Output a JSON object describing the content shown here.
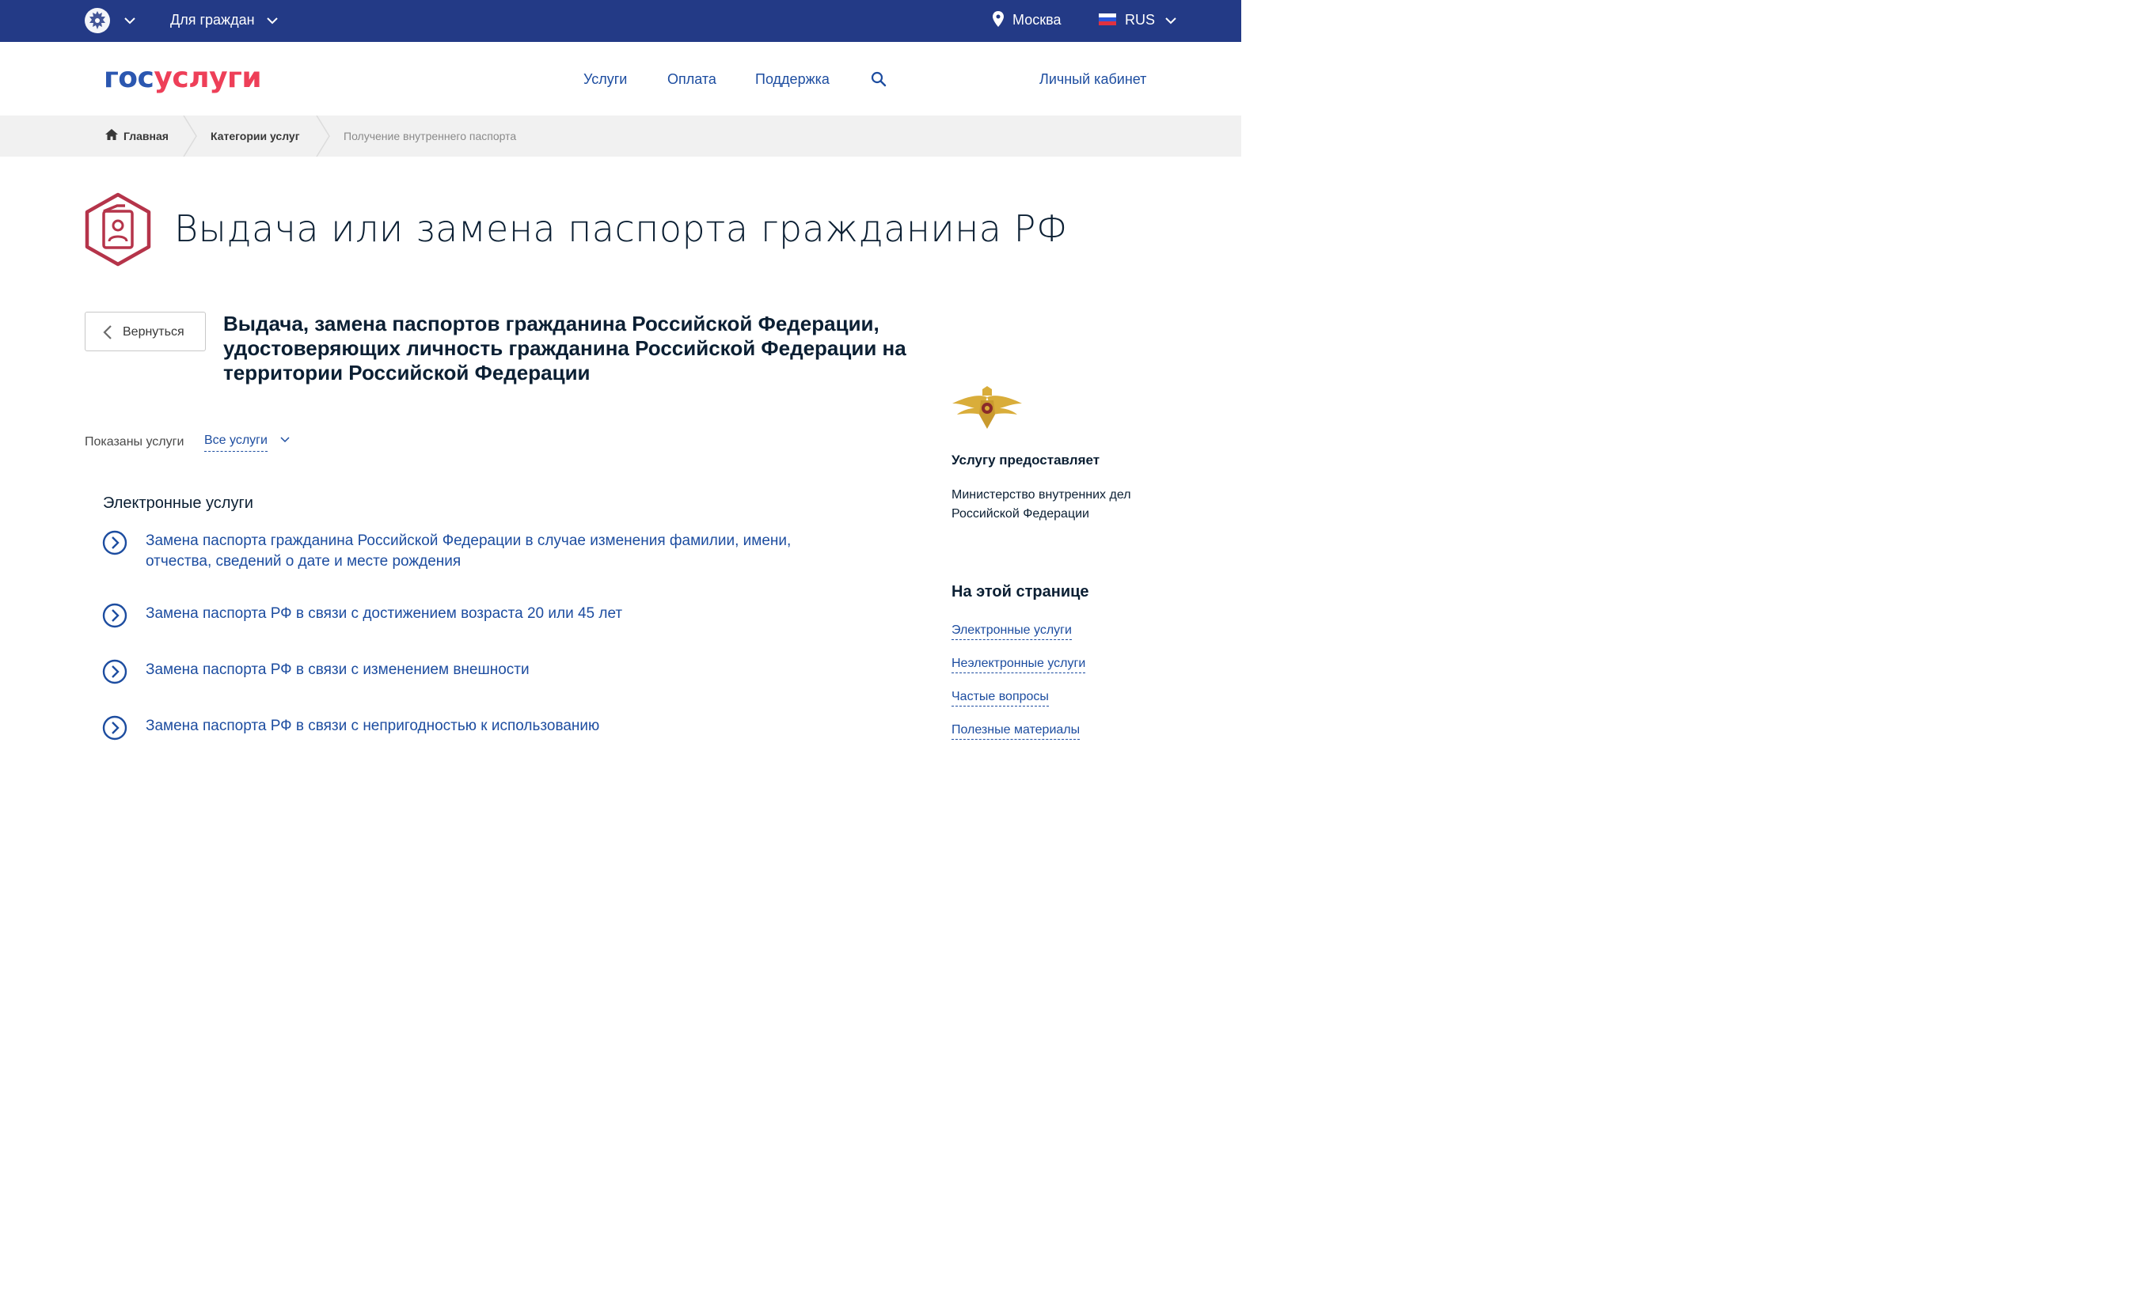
{
  "topbar": {
    "audience": "Для граждан",
    "city": "Москва",
    "language": "RUS",
    "colors": {
      "background": "#233a86"
    }
  },
  "header": {
    "logo_part1": "гос",
    "logo_part2": "услуги",
    "nav": [
      "Услуги",
      "Оплата",
      "Поддержка"
    ],
    "cabinet": "Личный кабинет",
    "search_icon": "search-icon"
  },
  "breadcrumbs": [
    "Главная",
    "Категории услуг",
    "Получение внутреннего паспорта"
  ],
  "page": {
    "title": "Выдача или замена паспорта гражданина РФ",
    "back_label": "Вернуться",
    "service_heading": "Выдача, замена паспортов гражданина Российской Федерации, удостоверяющих личность гражданина Российской Федерации на территории Российской Федерации",
    "shown_label": "Показаны услуги",
    "filter_value": "Все услуги",
    "section_title": "Электронные услуги",
    "services": [
      "Замена паспорта гражданина Российской Федерации в случае изменения фамилии, имени, отчества, сведений о дате и месте рождения",
      "Замена паспорта РФ в связи с достижением возраста 20 или 45 лет",
      "Замена паспорта РФ в связи с изменением внешности",
      "Замена паспорта РФ в связи с непригодностью к использованию"
    ]
  },
  "sidebar": {
    "provider_label": "Услугу предоставляет",
    "provider_name": "Министерство внутренних дел Российской Федерации",
    "onpage_title": "На этой странице",
    "onpage_links": [
      "Электронные услуги",
      "Неэлектронные услуги",
      "Частые вопросы",
      "Полезные материалы"
    ]
  },
  "colors": {
    "accent_blue": "#1d4da0",
    "brand_red": "#ee3f58",
    "passport_icon": "#b5344a"
  }
}
